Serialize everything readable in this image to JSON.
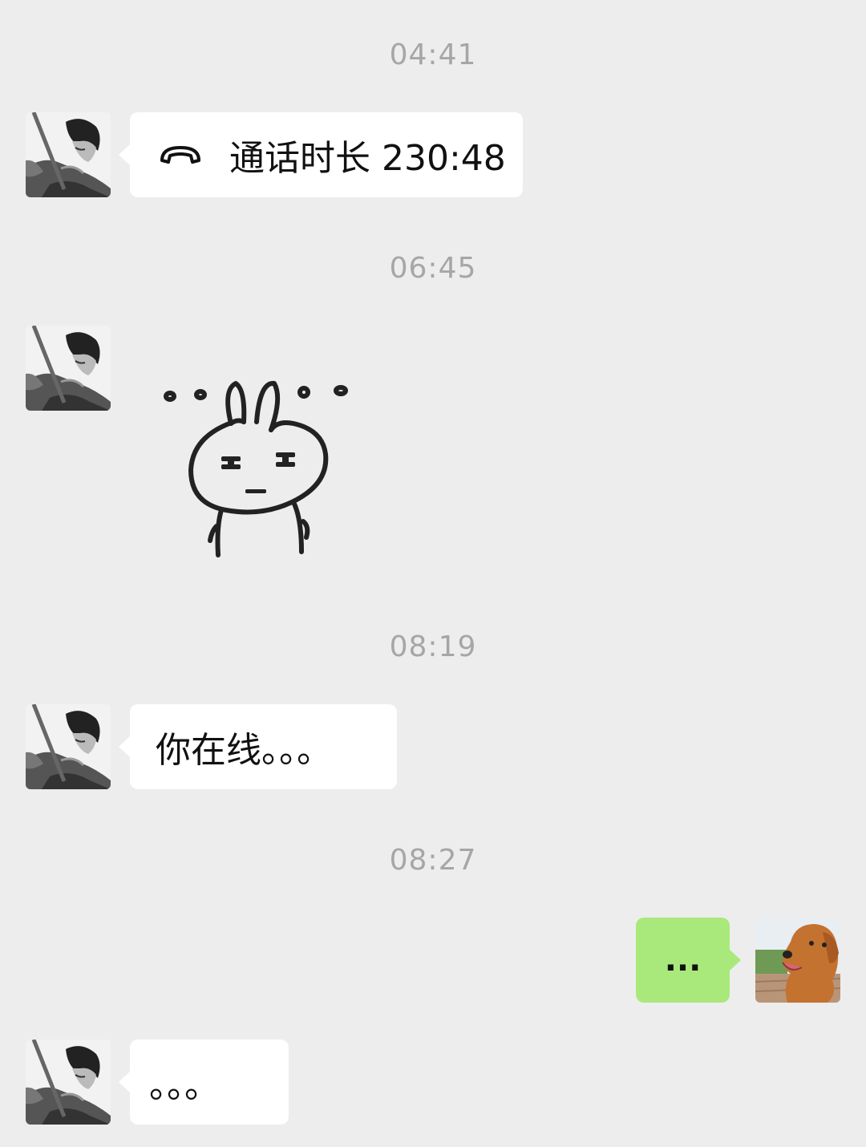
{
  "messages": [
    {
      "timestamp": "04:41",
      "type": "call",
      "sender": "contact",
      "text": "通话时长 230:48",
      "icon": "phone-hangup-icon"
    },
    {
      "timestamp": "06:45",
      "type": "sticker",
      "sender": "contact",
      "sticker": "rabbit-sticker"
    },
    {
      "timestamp": "08:19",
      "type": "text",
      "sender": "contact",
      "text": "你在线。。。"
    },
    {
      "timestamp": "08:27",
      "type": "text",
      "sender": "me",
      "text": "..."
    },
    {
      "type": "text",
      "sender": "contact",
      "text": "。。。"
    }
  ],
  "colors": {
    "background": "#ededed",
    "incoming_bubble": "#ffffff",
    "outgoing_bubble": "#a9e97b",
    "timestamp": "#a6a6a6"
  },
  "avatars": {
    "contact": "contact-avatar-icon",
    "me": "dog-avatar-icon"
  }
}
